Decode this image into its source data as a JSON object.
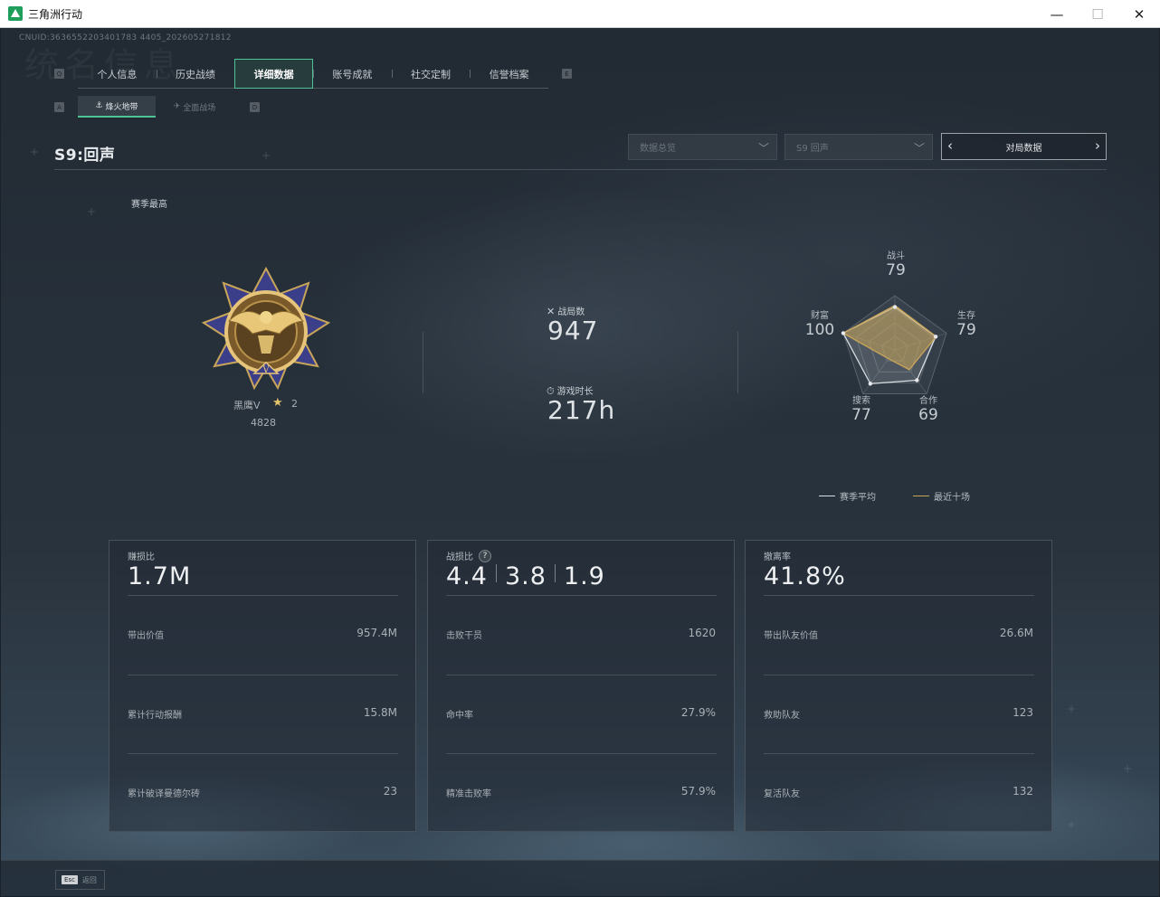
{
  "window": {
    "title": "三角洲行动",
    "minimize": "—",
    "maximize": "☐",
    "close": "✕"
  },
  "uid": "CNUID:3636552203401783 4405_202605271812",
  "bg_title": "统名信息",
  "tabs": {
    "key_left": "Q",
    "key_right": "E",
    "items": [
      {
        "label": "个人信息"
      },
      {
        "label": "历史战绩"
      },
      {
        "label": "详细数据",
        "active": true
      },
      {
        "label": "账号成就"
      },
      {
        "label": "社交定制"
      },
      {
        "label": "信誉档案"
      }
    ]
  },
  "subtabs": {
    "key_left": "A",
    "key_right": "D",
    "items": [
      {
        "label": "烽火地带",
        "icon": "⚓",
        "active": true
      },
      {
        "label": "全面战场",
        "icon": "✈",
        "active": false
      }
    ]
  },
  "season_title": "S9:回声",
  "filters": {
    "dropdown1": "数据总览",
    "dropdown2": "S9 回声",
    "pager_label": "对局数据"
  },
  "season_high_label": "赛季最高",
  "rank": {
    "name": "黑鹰V",
    "stars": "2",
    "score": "4828"
  },
  "stats": {
    "matches_label": "战局数",
    "matches_value": "947",
    "playtime_label": "游戏时长",
    "playtime_value": "217h"
  },
  "radar": {
    "axes": [
      {
        "label": "战斗",
        "value": "79"
      },
      {
        "label": "生存",
        "value": "79"
      },
      {
        "label": "合作",
        "value": "69"
      },
      {
        "label": "搜索",
        "value": "77"
      },
      {
        "label": "财富",
        "value": "100"
      }
    ],
    "season_avg": [
      79,
      79,
      69,
      77,
      100
    ],
    "recent_ten": [
      82,
      80,
      45,
      20,
      100
    ],
    "colors": {
      "season_avg": "#d8dde2",
      "recent_ten": "#c9a55a"
    }
  },
  "legend": {
    "season_avg": "赛季平均",
    "recent_ten": "最近十场"
  },
  "cards": [
    {
      "title": "赚损比",
      "big": [
        "1.7M"
      ],
      "rows": [
        {
          "label": "带出价值",
          "value": "957.4M"
        },
        {
          "label": "累计行动报酬",
          "value": "15.8M"
        },
        {
          "label": "累计破译曼德尔砖",
          "value": "23"
        }
      ]
    },
    {
      "title": "战损比",
      "help": "?",
      "big": [
        "4.4",
        "3.8",
        "1.9"
      ],
      "rows": [
        {
          "label": "击败干员",
          "value": "1620"
        },
        {
          "label": "命中率",
          "value": "27.9%"
        },
        {
          "label": "精准击败率",
          "value": "57.9%"
        }
      ]
    },
    {
      "title": "撤离率",
      "big": [
        "41.8%"
      ],
      "rows": [
        {
          "label": "带出队友价值",
          "value": "26.6M"
        },
        {
          "label": "救助队友",
          "value": "123"
        },
        {
          "label": "复活队友",
          "value": "132"
        }
      ]
    }
  ],
  "footer": {
    "esc_key": "Esc",
    "esc_label": "返回"
  }
}
